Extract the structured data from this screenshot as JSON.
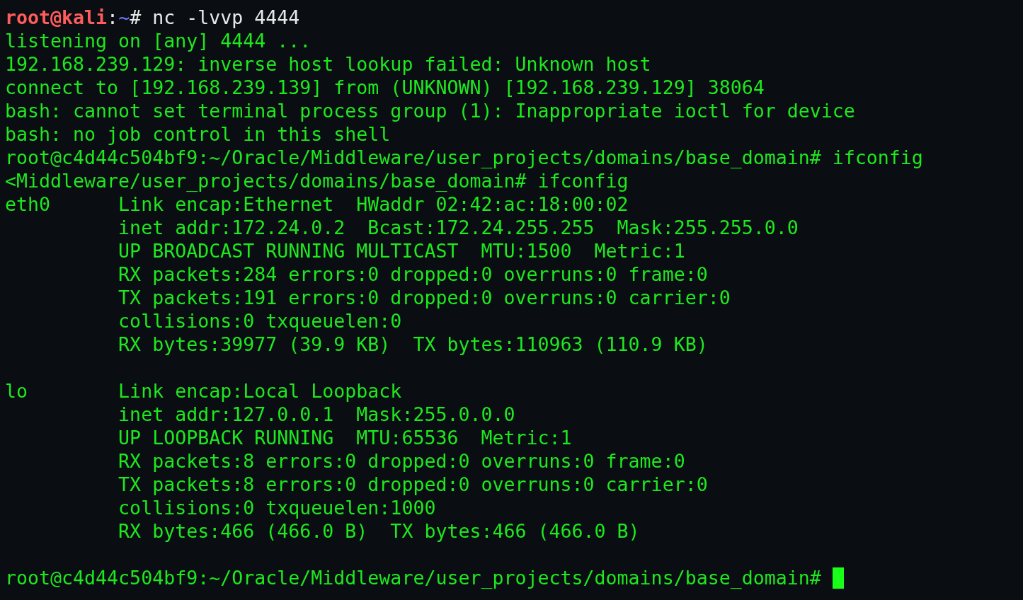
{
  "terminal": {
    "first_prompt": {
      "user_host": "root@kali",
      "separator": ":",
      "path": "~",
      "command": "# nc -lvvp 4444"
    },
    "lines": [
      {
        "kind": "text",
        "text": "listening on [any] 4444 ..."
      },
      {
        "kind": "text",
        "text": "192.168.239.129: inverse host lookup failed: Unknown host"
      },
      {
        "kind": "text",
        "text": "connect to [192.168.239.139] from (UNKNOWN) [192.168.239.129] 38064"
      },
      {
        "kind": "text",
        "text": "bash: cannot set terminal process group (1): Inappropriate ioctl for device"
      },
      {
        "kind": "text",
        "text": "bash: no job control in this shell"
      },
      {
        "kind": "text",
        "text": "root@c4d44c504bf9:~/Oracle/Middleware/user_projects/domains/base_domain# ifconfig"
      },
      {
        "kind": "text",
        "text": "<Middleware/user_projects/domains/base_domain# ifconfig"
      },
      {
        "kind": "text",
        "text": "eth0      Link encap:Ethernet  HWaddr 02:42:ac:18:00:02"
      },
      {
        "kind": "text",
        "text": "          inet addr:172.24.0.2  Bcast:172.24.255.255  Mask:255.255.0.0"
      },
      {
        "kind": "text",
        "text": "          UP BROADCAST RUNNING MULTICAST  MTU:1500  Metric:1"
      },
      {
        "kind": "text",
        "text": "          RX packets:284 errors:0 dropped:0 overruns:0 frame:0"
      },
      {
        "kind": "text",
        "text": "          TX packets:191 errors:0 dropped:0 overruns:0 carrier:0"
      },
      {
        "kind": "text",
        "text": "          collisions:0 txqueuelen:0"
      },
      {
        "kind": "text",
        "text": "          RX bytes:39977 (39.9 KB)  TX bytes:110963 (110.9 KB)"
      },
      {
        "kind": "blank"
      },
      {
        "kind": "text",
        "text": "lo        Link encap:Local Loopback"
      },
      {
        "kind": "text",
        "text": "          inet addr:127.0.0.1  Mask:255.0.0.0"
      },
      {
        "kind": "text",
        "text": "          UP LOOPBACK RUNNING  MTU:65536  Metric:1"
      },
      {
        "kind": "text",
        "text": "          RX packets:8 errors:0 dropped:0 overruns:0 frame:0"
      },
      {
        "kind": "text",
        "text": "          TX packets:8 errors:0 dropped:0 overruns:0 carrier:0"
      },
      {
        "kind": "text",
        "text": "          collisions:0 txqueuelen:1000"
      },
      {
        "kind": "text",
        "text": "          RX bytes:466 (466.0 B)  TX bytes:466 (466.0 B)"
      },
      {
        "kind": "blank"
      }
    ],
    "final_prompt": {
      "text": "root@c4d44c504bf9:~/Oracle/Middleware/user_projects/domains/base_domain#",
      "cursor": true
    }
  }
}
